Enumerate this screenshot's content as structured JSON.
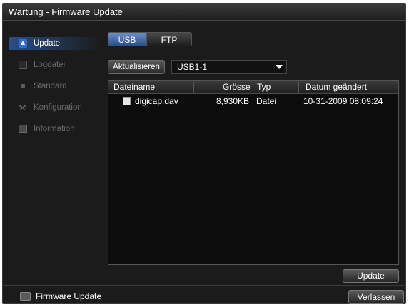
{
  "window": {
    "title": "Wartung - Firmware Update"
  },
  "sidebar": {
    "items": [
      {
        "label": "Update",
        "icon": "update-icon",
        "active": true
      },
      {
        "label": "Logdatei",
        "icon": "log-icon",
        "active": false
      },
      {
        "label": "Standard",
        "icon": "default-icon",
        "active": false
      },
      {
        "label": "Konfiguration",
        "icon": "wrench-icon",
        "active": false
      },
      {
        "label": "Information",
        "icon": "info-icon",
        "active": false
      }
    ]
  },
  "tabs": [
    {
      "label": "USB",
      "active": true
    },
    {
      "label": "FTP",
      "active": false
    }
  ],
  "toolbar": {
    "refresh_label": "Aktualisieren",
    "device_value": "USB1-1"
  },
  "filelist": {
    "columns": [
      "Dateiname",
      "Grösse",
      "Typ",
      "Datum geändert"
    ],
    "rows": [
      {
        "name": "digicap.dav",
        "size": "8,930KB",
        "type": "Datei",
        "date": "10-31-2009 08:09:24"
      }
    ]
  },
  "actions": {
    "update_label": "Update",
    "exit_label": "Verlassen"
  },
  "footer": {
    "label": "Firmware Update"
  },
  "colors": {
    "accent": "#2f6fd0",
    "background": "#1b1b1b"
  }
}
